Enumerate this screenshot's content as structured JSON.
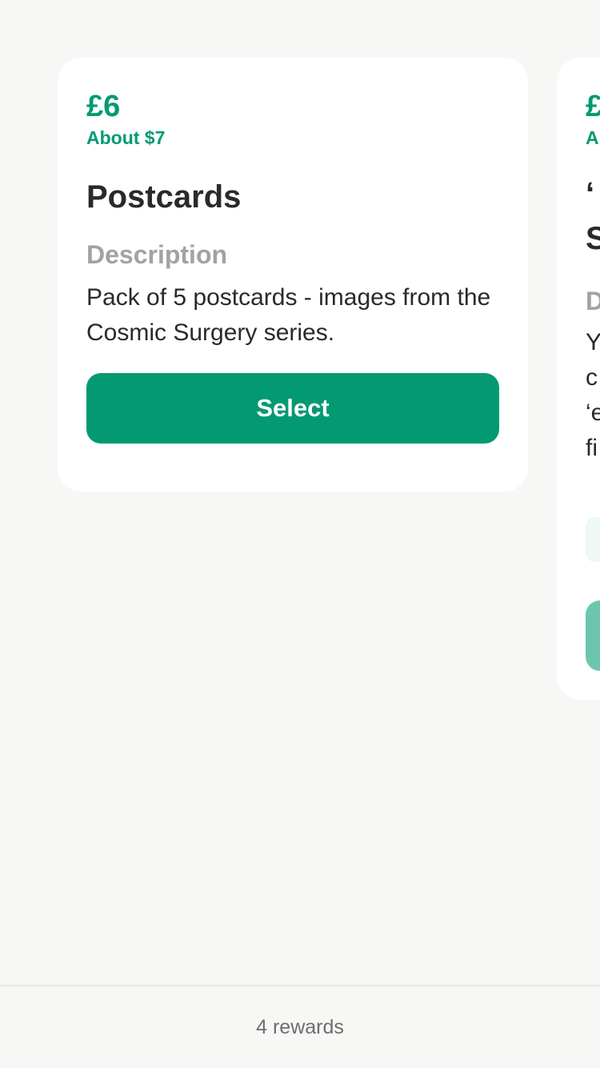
{
  "rewards": [
    {
      "price": "£6",
      "converted": "About $7",
      "title": "Postcards",
      "description_label": "Description",
      "description": "Pack of 5 postcards - images from the Cosmic Surgery series.",
      "select_label": "Select"
    },
    {
      "price": "£",
      "converted": "A",
      "title_line1": "‘",
      "title_line2": "S",
      "description_label": "D",
      "description_lines": [
        "Y",
        "c",
        "‘e",
        "fi"
      ]
    }
  ],
  "footer": {
    "count_label": "4 rewards"
  },
  "colors": {
    "accent": "#039a72",
    "background": "#f7f7f5",
    "card": "#ffffff",
    "text": "#2a2a2a",
    "muted": "#a2a2a2"
  }
}
